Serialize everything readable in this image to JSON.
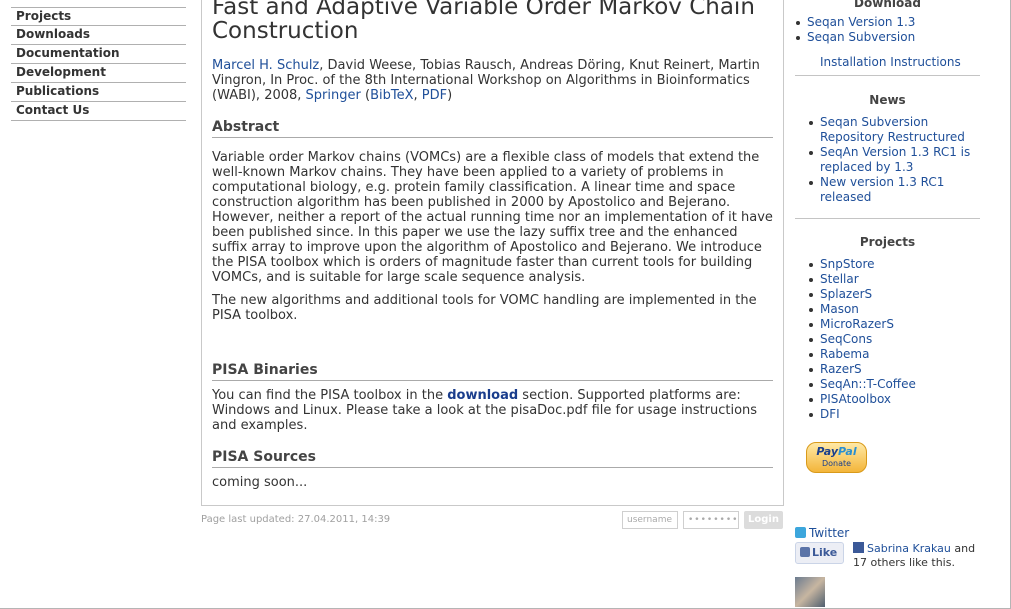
{
  "leftnav": [
    "Projects",
    "Downloads",
    "Documentation",
    "Development",
    "Publications",
    "Contact Us"
  ],
  "main": {
    "title": "Fast and Adaptive Variable Order Markov Chain Construction",
    "author_link": "Marcel H. Schulz",
    "authors_rest": ", David Weese, Tobias Rausch, Andreas Döring, Knut Reinert, Martin Vingron, In Proc. of the 8th International Workshop on Algorithms in Bioinformatics (WABI), 2008, ",
    "springer": "Springer",
    "paren_open": " (",
    "bibtex": "BibTeX",
    "comma": ", ",
    "pdf": "PDF",
    "paren_close": ")",
    "abstract_heading": "Abstract",
    "abstract_p1": "Variable order Markov chains (VOMCs) are a flexible class of models that extend the well-known Markov chains. They have been applied to a variety of problems in computational biology, e.g. protein family classification. A linear time and space construction algorithm has been published in 2000 by Apostolico and Bejerano. However, neither a report of the actual running time nor an implementation of it have been published since. In this paper we use the lazy suffix tree and the enhanced suffix array to improve upon the algorithm of Apostolico and Bejerano. We introduce the PISA toolbox which is orders of magnitude faster than current tools for building VOMCs, and is suitable for large scale sequence analysis.",
    "abstract_p2": "The new algorithms and additional tools for VOMC handling are implemented in the PISA toolbox.",
    "binaries_heading": "PISA Binaries",
    "binaries_pre": "You can find the PISA toolbox in the ",
    "binaries_link": "download",
    "binaries_post": " section. Supported platforms are: Windows and Linux. Please take a look at the pisaDoc.pdf file for usage instructions and examples.",
    "sources_heading": "PISA Sources",
    "sources_text": "coming soon..."
  },
  "footer": {
    "updated": "Page last updated: 27.04.2011, 14:39",
    "username_placeholder": "username",
    "password_mask": "••••••••",
    "login": "Login"
  },
  "sidebar": {
    "download_heading": "Download",
    "download_items": [
      "Seqan Version 1.3",
      "Seqan Subversion"
    ],
    "install": "Installation Instructions",
    "news_heading": "News",
    "news_items": [
      "Seqan Subversion Repository Restructured",
      "SeqAn Version 1.3 RC1 is replaced by 1.3",
      "New version 1.3 RC1 released"
    ],
    "projects_heading": "Projects",
    "projects_items": [
      "SnpStore",
      "Stellar",
      "SplazerS",
      "Mason",
      "MicroRazerS",
      "SeqCons",
      "Rabema",
      "RazerS",
      "SeqAn::T-Coffee",
      "PISAtoolbox",
      "DFI"
    ],
    "paypal_pay": "Pay",
    "paypal_pal": "Pal",
    "paypal_donate": "Donate",
    "twitter": "Twitter",
    "like": "Like",
    "fb_name": "Sabrina Krakau",
    "fb_rest": " and 17 others like this."
  }
}
